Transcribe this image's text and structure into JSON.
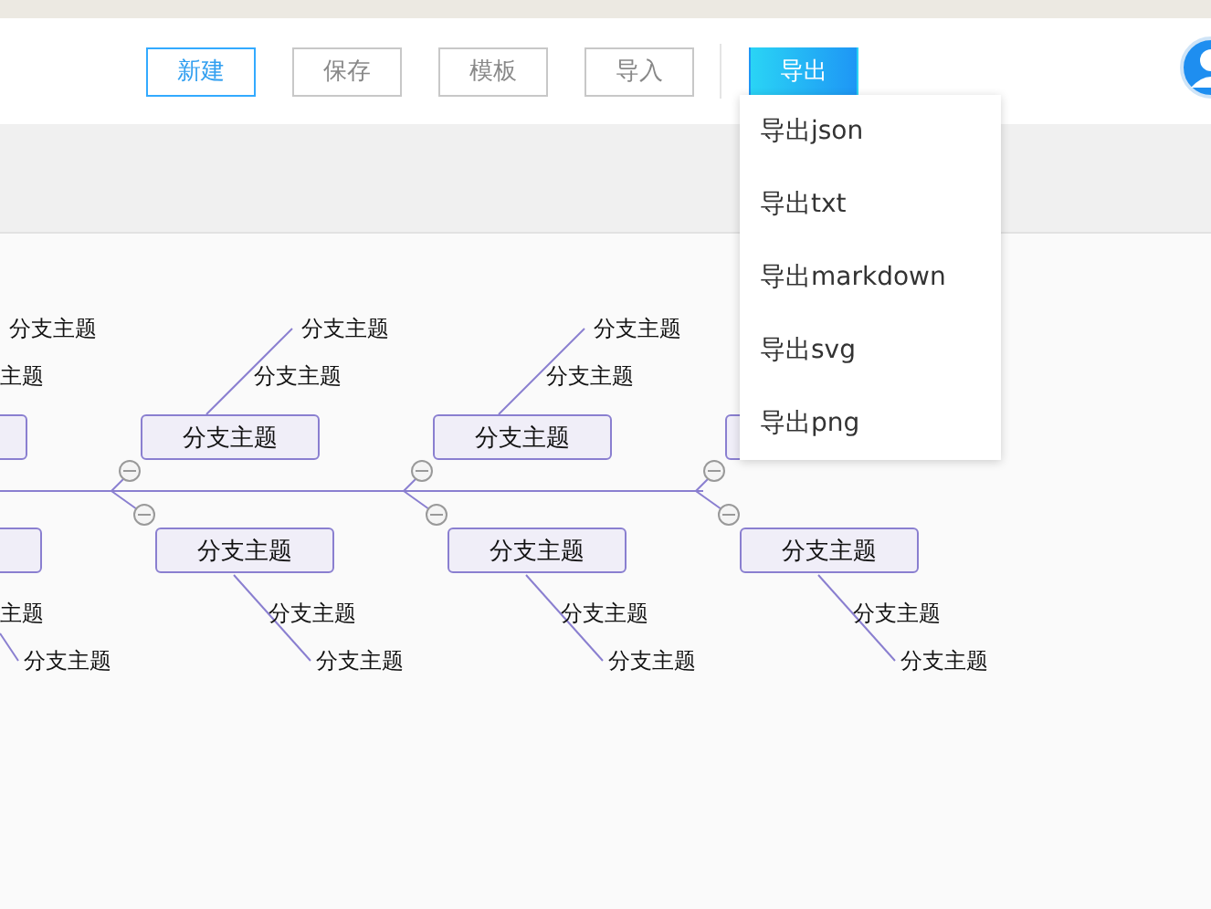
{
  "toolbar": {
    "buttons": [
      {
        "label": "新建",
        "kind": "primary-outline",
        "selected": false
      },
      {
        "label": "保存",
        "kind": "outline",
        "selected": false
      },
      {
        "label": "模板",
        "kind": "outline",
        "selected": false
      },
      {
        "label": "导入",
        "kind": "outline",
        "selected": false
      },
      {
        "label": "导出",
        "kind": "outline",
        "selected": true
      }
    ]
  },
  "export_menu": {
    "items": [
      "导出json",
      "导出txt",
      "导出markdown",
      "导出svg",
      "导出png"
    ]
  },
  "fishbone": {
    "branches": [
      {
        "kind": "top",
        "subtopics": [
          "分支主题",
          "主题"
        ]
      },
      {
        "kind": "top",
        "label": "分支主题",
        "subtopics": [
          "分支主题",
          "分支主题"
        ]
      },
      {
        "kind": "top",
        "label": "分支主题",
        "subtopics": [
          "分支主题",
          "分支主题"
        ]
      },
      {
        "kind": "top"
      },
      {
        "kind": "bottom",
        "subtopics": [
          "主题",
          "分支主题"
        ]
      },
      {
        "kind": "bottom",
        "label": "分支主题",
        "subtopics": [
          "分支主题",
          "分支主题"
        ]
      },
      {
        "kind": "bottom",
        "label": "分支主题",
        "subtopics": [
          "分支主题",
          "分支主题"
        ]
      },
      {
        "kind": "bottom",
        "label": "分支主题",
        "subtopics": [
          "分支主题",
          "分支主题"
        ]
      }
    ]
  }
}
